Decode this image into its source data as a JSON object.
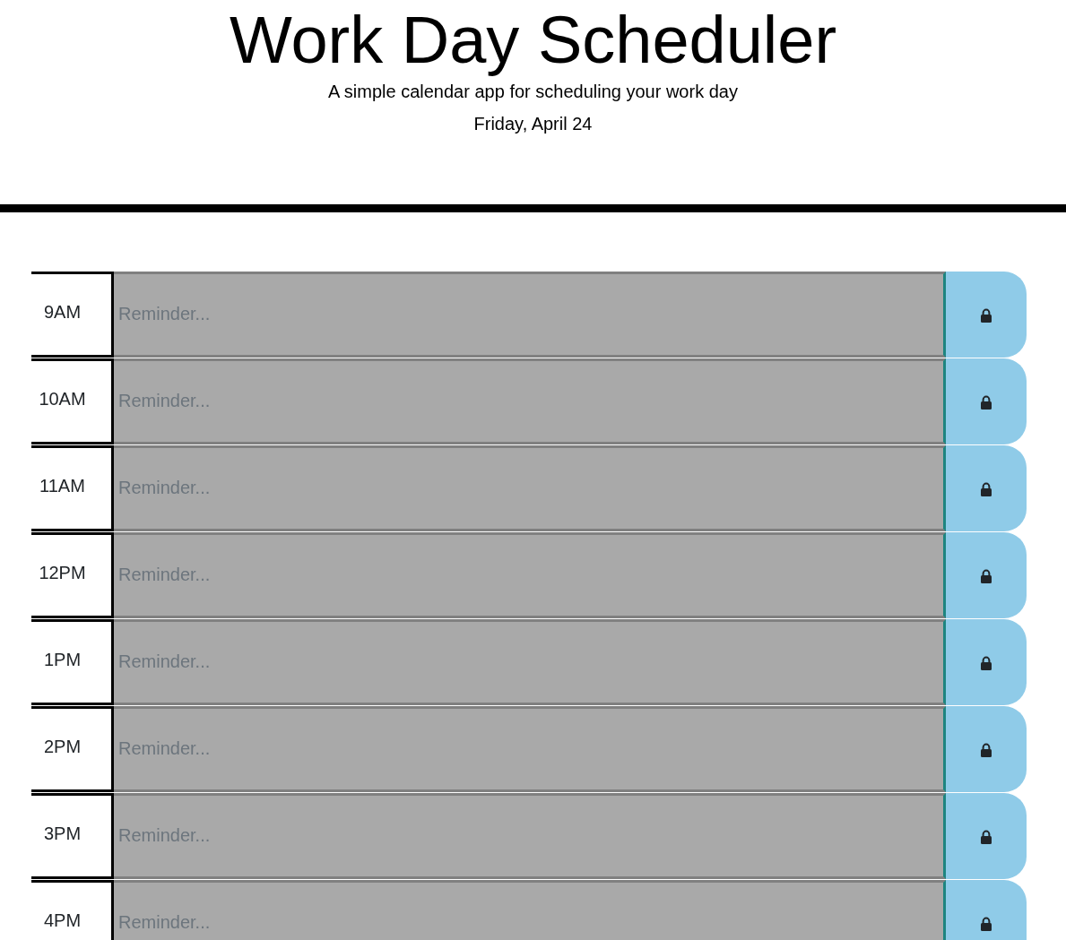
{
  "header": {
    "title": "Work Day Scheduler",
    "subtitle": "A simple calendar app for scheduling your work day",
    "date": "Friday, April 24"
  },
  "time_blocks": [
    {
      "hour": "9AM",
      "placeholder": "Reminder..."
    },
    {
      "hour": "10AM",
      "placeholder": "Reminder..."
    },
    {
      "hour": "11AM",
      "placeholder": "Reminder..."
    },
    {
      "hour": "12PM",
      "placeholder": "Reminder..."
    },
    {
      "hour": "1PM",
      "placeholder": "Reminder..."
    },
    {
      "hour": "2PM",
      "placeholder": "Reminder..."
    },
    {
      "hour": "3PM",
      "placeholder": "Reminder..."
    },
    {
      "hour": "4PM",
      "placeholder": "Reminder..."
    }
  ]
}
